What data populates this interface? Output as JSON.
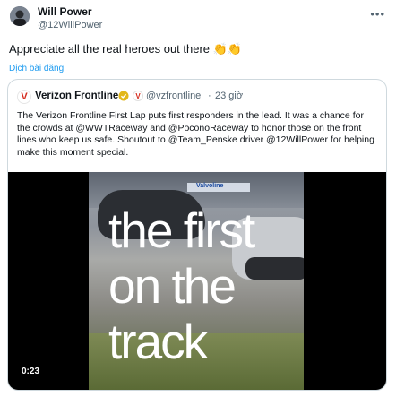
{
  "tweet": {
    "author_name": "Will Power",
    "author_handle": "@12WillPower",
    "text": "Appreciate all the real heroes out there 👏👏",
    "translate_label": "Dịch bài đăng",
    "more_icon": "more-horizontal-icon"
  },
  "quoted": {
    "logo_letter": "V",
    "author_name": "Verizon Frontline",
    "author_handle": "@vzfrontline",
    "separator": "·",
    "time": "23 giờ",
    "text": "The Verizon Frontline First Lap puts first responders in the lead. It was a chance for the crowds at @WWTRaceway and @PoconoRaceway to honor those on the front lines who keep us safe. Shoutout to @Team_Penske driver @12WillPower for helping make this moment special.",
    "verified_color": "#e2b719",
    "video": {
      "overlay_lines": [
        "the first",
        "on the",
        "track"
      ],
      "banner_text": "Valvoline",
      "duration": "0:23"
    }
  },
  "colors": {
    "link": "#1d9bf0",
    "secondary_text": "#536471",
    "border": "#cfd9de"
  }
}
